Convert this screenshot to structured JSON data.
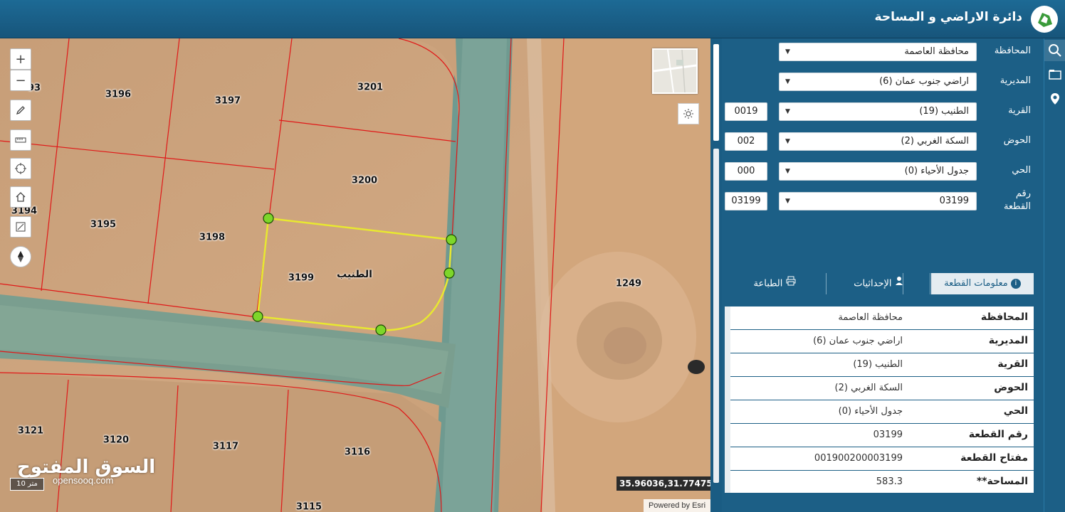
{
  "header": {
    "title": "دائرة الاراضي و المساحة"
  },
  "map": {
    "village_label": "الطنيب",
    "plots": [
      {
        "id": "3193",
        "label": "93"
      },
      {
        "id": "3196",
        "label": "3196"
      },
      {
        "id": "3197",
        "label": "3197"
      },
      {
        "id": "3201",
        "label": "3201"
      },
      {
        "id": "3200",
        "label": "3200"
      },
      {
        "id": "3194",
        "label": "3194"
      },
      {
        "id": "3195",
        "label": "3195"
      },
      {
        "id": "3198",
        "label": "3198"
      },
      {
        "id": "3199",
        "label": "3199"
      },
      {
        "id": "1249",
        "label": "1249"
      },
      {
        "id": "3121",
        "label": "3121"
      },
      {
        "id": "3120",
        "label": "3120"
      },
      {
        "id": "3117",
        "label": "3117"
      },
      {
        "id": "3116",
        "label": "3116"
      },
      {
        "id": "3115",
        "label": "3115"
      }
    ],
    "coordinates": "35.96036,31.77475",
    "powered_by": "Powered by Esri",
    "scale": "10 متر",
    "watermark_ar": "السوق المفتوح",
    "watermark_en": "opensooq.com"
  },
  "form": {
    "governorate": {
      "label": "المحافظة",
      "value": "محافظة العاصمة"
    },
    "directorate": {
      "label": "المديرية",
      "value": "اراضي جنوب عمان (6)"
    },
    "village": {
      "label": "القرية",
      "value": "الطنيب (19)",
      "code": "0019"
    },
    "basin": {
      "label": "الحوض",
      "value": "السكة الغربي (2)",
      "code": "002"
    },
    "district": {
      "label": "الحي",
      "value": "جدول الأحياء (0)",
      "code": "000"
    },
    "parcel": {
      "label": "رقم القطعة",
      "value": "03199",
      "code": "03199"
    }
  },
  "tabs": [
    {
      "label": "معلومات القطعة",
      "icon": "info-icon",
      "active": true
    },
    {
      "label": "الإحداثيات",
      "icon": "person-pin-icon",
      "active": false
    },
    {
      "label": "الطباعة",
      "icon": "printer-icon",
      "active": false
    }
  ],
  "info": [
    {
      "key": "المحافظة",
      "value": "محافظة العاصمة"
    },
    {
      "key": "المديرية",
      "value": "اراضي جنوب عمان (6)"
    },
    {
      "key": "القرية",
      "value": "الطنيب (19)"
    },
    {
      "key": "الحوض",
      "value": "السكة الغربي (2)"
    },
    {
      "key": "الحي",
      "value": "جدول الأحياء (0)"
    },
    {
      "key": "رقم القطعة",
      "value": "03199"
    },
    {
      "key": "مفتاح القطعة",
      "value": "001900200003199"
    },
    {
      "key": "المساحة**",
      "value": "583.3"
    }
  ],
  "colors": {
    "header": "#1d6a95",
    "panel": "#1c5f86",
    "parcel_outline": "#e8e830",
    "boundary": "#e01818"
  }
}
